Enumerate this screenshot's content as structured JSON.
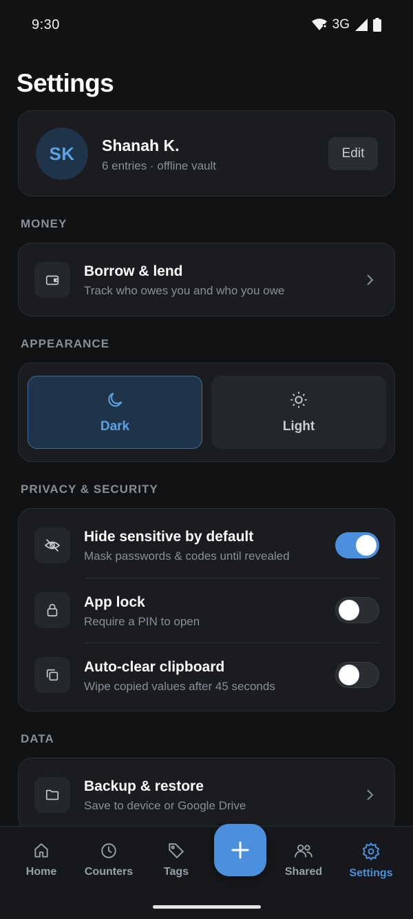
{
  "status_bar": {
    "time": "9:30",
    "network": "3G"
  },
  "page": {
    "title": "Settings"
  },
  "profile": {
    "initials": "SK",
    "name": "Shanah K.",
    "subtitle": "6 entries · offline vault",
    "edit_label": "Edit"
  },
  "money": {
    "section_label": "MONEY",
    "items": [
      {
        "icon": "wallet-icon",
        "title": "Borrow & lend",
        "subtitle": "Track who owes you and who you owe"
      }
    ]
  },
  "appearance": {
    "section_label": "APPEARANCE",
    "options": [
      {
        "icon": "moon-icon",
        "label": "Dark",
        "selected": true
      },
      {
        "icon": "sun-icon",
        "label": "Light",
        "selected": false
      }
    ]
  },
  "privacy": {
    "section_label": "PRIVACY & SECURITY",
    "items": [
      {
        "icon": "eye-off-icon",
        "title": "Hide sensitive by default",
        "subtitle": "Mask passwords & codes until revealed",
        "enabled": true
      },
      {
        "icon": "lock-icon",
        "title": "App lock",
        "subtitle": "Require a PIN to open",
        "enabled": false
      },
      {
        "icon": "copy-icon",
        "title": "Auto-clear clipboard",
        "subtitle": "Wipe copied values after 45 seconds",
        "enabled": false
      }
    ]
  },
  "data_section": {
    "section_label": "DATA",
    "items": [
      {
        "icon": "folder-icon",
        "title": "Backup & restore",
        "subtitle": "Save to device or Google Drive"
      }
    ]
  },
  "bottom_nav": {
    "items": [
      {
        "icon": "home-icon",
        "label": "Home",
        "active": false
      },
      {
        "icon": "clock-icon",
        "label": "Counters",
        "active": false
      },
      {
        "icon": "tag-icon",
        "label": "Tags",
        "active": false
      },
      {
        "icon": "people-icon",
        "label": "Shared",
        "active": false
      },
      {
        "icon": "gear-icon",
        "label": "Settings",
        "active": true
      }
    ],
    "fab_icon": "plus-icon"
  },
  "colors": {
    "background": "#111214",
    "card": "#1a1c1f",
    "accent": "#4a90dc",
    "muted_text": "#8a8f97"
  }
}
